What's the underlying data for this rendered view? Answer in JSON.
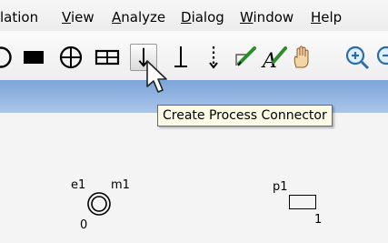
{
  "menubar": {
    "items": [
      {
        "pre": "",
        "mn": "",
        "post": "lation"
      },
      {
        "pre": "",
        "mn": "V",
        "post": "iew"
      },
      {
        "pre": "",
        "mn": "A",
        "post": "nalyze"
      },
      {
        "pre": "",
        "mn": "D",
        "post": "ialog"
      },
      {
        "pre": "",
        "mn": "W",
        "post": "indow"
      },
      {
        "pre": "",
        "mn": "H",
        "post": "elp"
      }
    ]
  },
  "toolbar": {
    "tools": [
      {
        "icon": "circle-tool-icon",
        "active": false
      },
      {
        "icon": "filled-rect-tool-icon",
        "active": false
      },
      {
        "icon": "crosshair-circle-tool-icon",
        "active": false
      },
      {
        "icon": "split-rect-tool-icon",
        "active": false
      },
      {
        "icon": "process-connector-icon",
        "active": true
      },
      {
        "icon": "connector-icon",
        "active": false
      },
      {
        "icon": "dotted-arrow-icon",
        "active": false
      },
      {
        "icon": "pen-edit-icon",
        "active": false
      },
      {
        "icon": "text-pen-icon",
        "active": false
      },
      {
        "icon": "hand-pan-icon",
        "active": false
      },
      {
        "icon": "zoom-in-icon",
        "active": false
      },
      {
        "icon": "zoom-out-icon",
        "active": false
      }
    ]
  },
  "tooltip": {
    "text": "Create Process Connector"
  },
  "canvas": {
    "element_e1": {
      "label": "e1",
      "model_label": "m1",
      "index": "0"
    },
    "element_p1": {
      "label": "p1",
      "index": "1"
    }
  },
  "colors": {
    "titlebar": "#8fb3e2",
    "tooltip_bg": "#fbfbe6",
    "menubar_bg": "#f2f2f2"
  }
}
